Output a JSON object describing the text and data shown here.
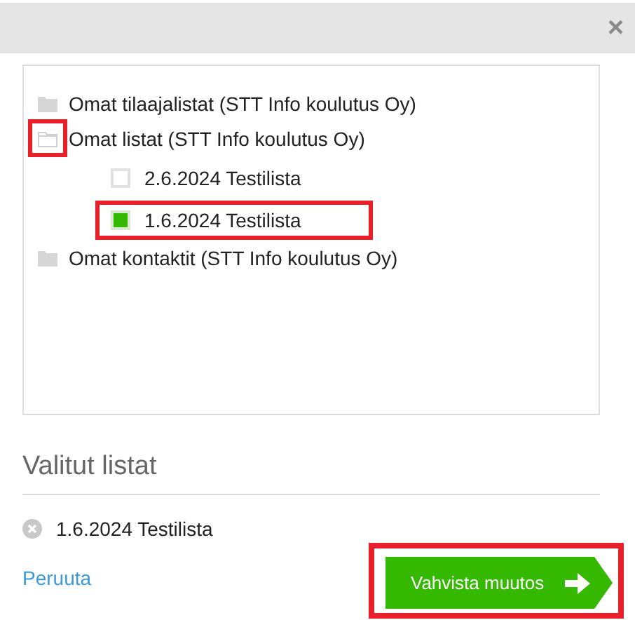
{
  "header": {
    "close": "×"
  },
  "tree": [
    {
      "label": "Omat tilaajalistat (STT Info koulutus Oy)",
      "expanded": false,
      "icon_highlighted": false
    },
    {
      "label": "Omat listat (STT Info koulutus Oy)",
      "expanded": true,
      "icon_highlighted": true,
      "children": [
        {
          "label": "2.6.2024 Testilista",
          "checked": false,
          "highlighted": false
        },
        {
          "label": "1.6.2024 Testilista",
          "checked": true,
          "highlighted": true
        }
      ]
    },
    {
      "label": "Omat kontaktit (STT Info koulutus Oy)",
      "expanded": false,
      "icon_highlighted": false
    }
  ],
  "selected_section": {
    "title": "Valitut listat",
    "items": [
      {
        "label": "1.6.2024 Testilista"
      }
    ]
  },
  "footer": {
    "cancel": "Peruuta",
    "confirm": {
      "label": "Vahvista muutos",
      "highlighted": true
    }
  }
}
